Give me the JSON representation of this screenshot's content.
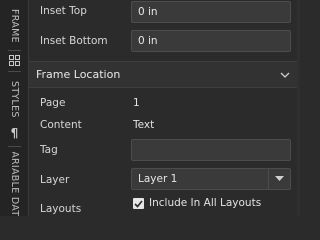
{
  "side_tabs": {
    "frame": "FRAME",
    "styles": "STYLES",
    "variable": "VARIABLE DATA",
    "grid_icon": "grid-icon",
    "paragraph_icon": "pilcrow-icon"
  },
  "inset": {
    "top_label": "Inset Top",
    "top_value": "0 in",
    "bottom_label": "Inset Bottom",
    "bottom_value": "0 in"
  },
  "frame_location": {
    "title": "Frame Location",
    "page_label": "Page",
    "page_value": "1",
    "content_label": "Content",
    "content_value": "Text",
    "tag_label": "Tag",
    "tag_value": "",
    "layer_label": "Layer",
    "layer_value": "Layer 1",
    "layouts_label": "Layouts",
    "include_all_label": "Include In All Layouts",
    "include_all_checked": true
  },
  "colors": {
    "background": "#2b2b2b",
    "field": "#3a3a3a",
    "section": "#323232"
  }
}
